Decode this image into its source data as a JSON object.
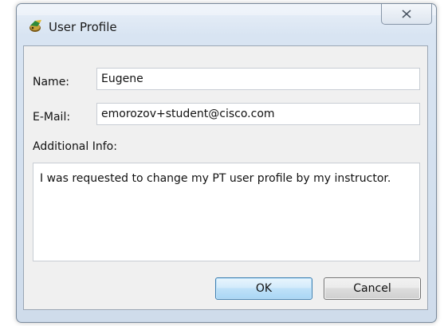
{
  "window": {
    "title": "User Profile",
    "icon": "packet-tracer-icon",
    "close_icon": "close-icon"
  },
  "form": {
    "name_label": "Name:",
    "name_value": "Eugene",
    "email_label": "E-Mail:",
    "email_value": "emorozov+student@cisco.com",
    "info_label": "Additional Info:",
    "info_value": "I was requested to change my PT user profile by my instructor."
  },
  "buttons": {
    "ok_label": "OK",
    "cancel_label": "Cancel"
  },
  "colors": {
    "default_button_border": "#3c7fb1",
    "client_background": "#f0f0f0"
  }
}
